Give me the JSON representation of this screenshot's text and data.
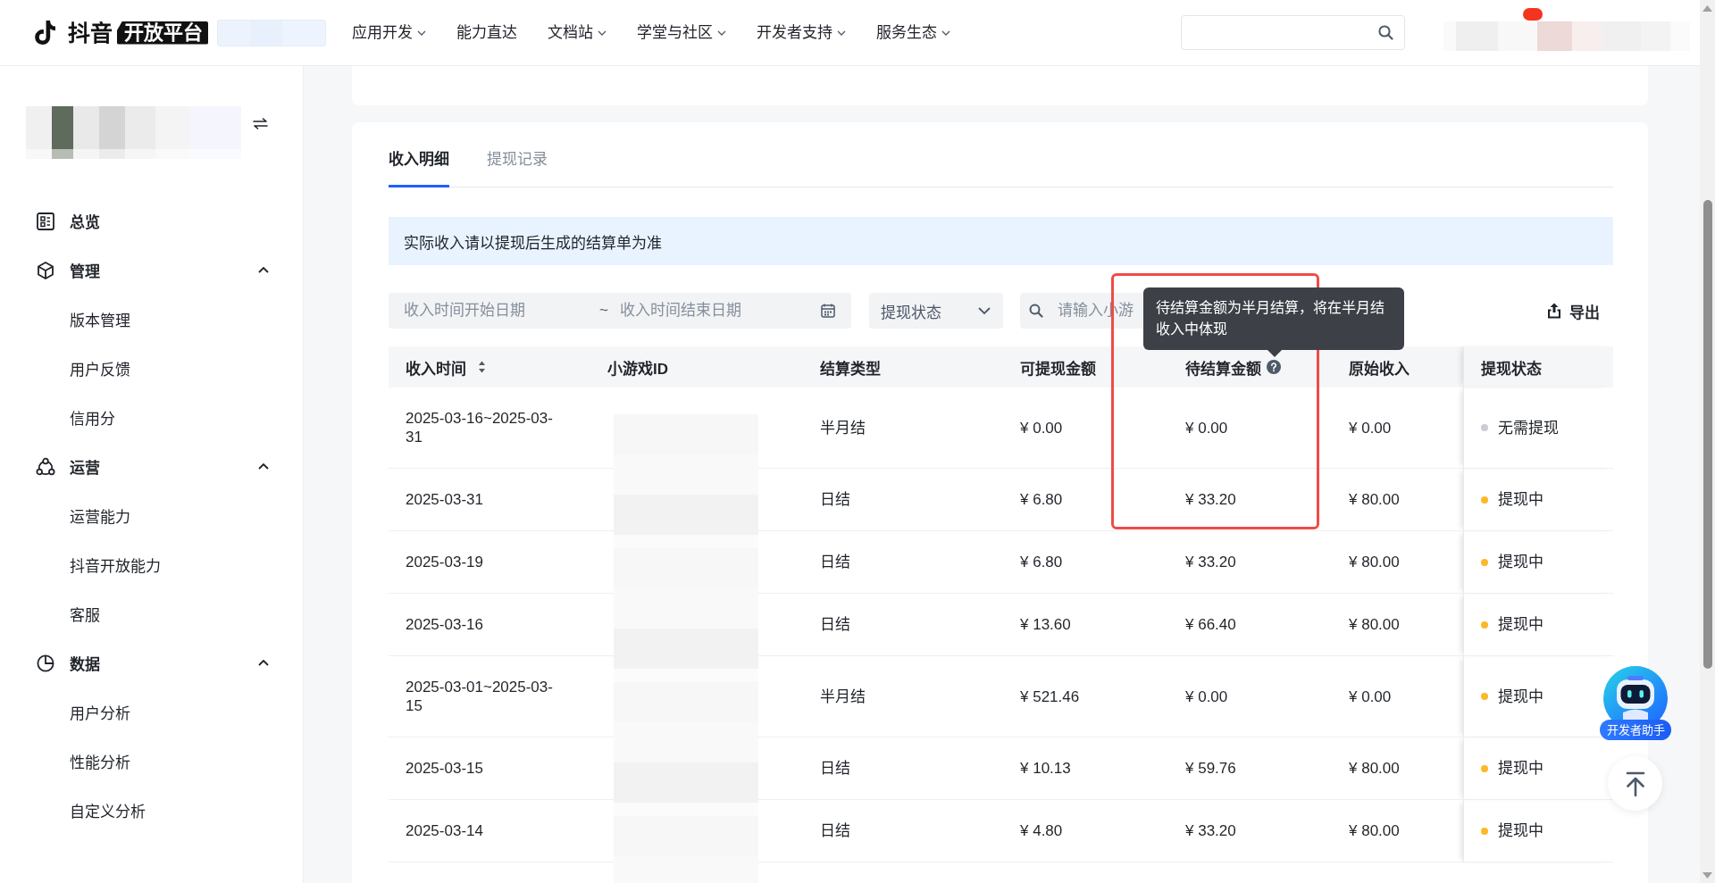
{
  "header": {
    "logo": {
      "brand": "抖音",
      "tag": "开放平台"
    },
    "nav": [
      {
        "label": "应用开发",
        "dropdown": true
      },
      {
        "label": "能力直达",
        "dropdown": false
      },
      {
        "label": "文档站",
        "dropdown": true
      },
      {
        "label": "学堂与社区",
        "dropdown": true
      },
      {
        "label": "开发者支持",
        "dropdown": true
      },
      {
        "label": "服务生态",
        "dropdown": true
      }
    ],
    "notification_badge": true
  },
  "sidebar": {
    "menu": [
      {
        "kind": "item",
        "label": "总览",
        "selected": false
      },
      {
        "kind": "group",
        "label": "管理",
        "expanded": true,
        "children": [
          {
            "label": "版本管理",
            "selected": false
          },
          {
            "label": "用户反馈",
            "selected": false
          },
          {
            "label": "信用分",
            "selected": false
          }
        ]
      },
      {
        "kind": "group",
        "label": "运营",
        "expanded": true,
        "children": [
          {
            "label": "运营能力",
            "selected": false
          },
          {
            "label": "抖音开放能力",
            "selected": false
          },
          {
            "label": "客服",
            "selected": false
          }
        ]
      },
      {
        "kind": "group",
        "label": "数据",
        "expanded": true,
        "children": [
          {
            "label": "用户分析",
            "selected": false
          },
          {
            "label": "性能分析",
            "selected": false
          },
          {
            "label": "自定义分析",
            "selected": false
          }
        ]
      }
    ]
  },
  "income": {
    "tabs": [
      {
        "label": "收入明细",
        "selected": true
      },
      {
        "label": "提现记录",
        "selected": false
      }
    ],
    "notice": "实际收入请以提现后生成的结算单为准",
    "filters": {
      "date_range": {
        "start_placeholder": "收入时间开始日期",
        "separator": "~",
        "end_placeholder": "收入时间结束日期"
      },
      "status_select": {
        "placeholder": "提现状态"
      },
      "search": {
        "placeholder": "请输入小游"
      },
      "export_label": "导出"
    },
    "table": {
      "columns": [
        {
          "label": "收入时间",
          "sortable": true,
          "help": false
        },
        {
          "label": "小游戏ID",
          "sortable": false,
          "help": false
        },
        {
          "label": "结算类型",
          "sortable": false,
          "help": false
        },
        {
          "label": "可提现金额",
          "sortable": false,
          "help": false
        },
        {
          "label": "待结算金额",
          "sortable": false,
          "help": true
        },
        {
          "label": "原始收入",
          "sortable": false,
          "help": false
        },
        {
          "label": "提现状态",
          "sortable": false,
          "help": false
        }
      ],
      "rows": [
        {
          "time": "2025-03-16~2025-03-31",
          "type": "半月结",
          "withdrawable": "¥ 0.00",
          "pending": "¥ 0.00",
          "original": "¥ 0.00",
          "status": {
            "label": "无需提现",
            "color": "#c9cdd4"
          }
        },
        {
          "time": "2025-03-31",
          "type": "日结",
          "withdrawable": "¥ 6.80",
          "pending": "¥ 33.20",
          "original": "¥ 80.00",
          "status": {
            "label": "提现中",
            "color": "#fbb829"
          }
        },
        {
          "time": "2025-03-19",
          "type": "日结",
          "withdrawable": "¥ 6.80",
          "pending": "¥ 33.20",
          "original": "¥ 80.00",
          "status": {
            "label": "提现中",
            "color": "#fbb829"
          }
        },
        {
          "time": "2025-03-16",
          "type": "日结",
          "withdrawable": "¥ 13.60",
          "pending": "¥ 66.40",
          "original": "¥ 80.00",
          "status": {
            "label": "提现中",
            "color": "#fbb829"
          }
        },
        {
          "time": "2025-03-01~2025-03-15",
          "type": "半月结",
          "withdrawable": "¥ 521.46",
          "pending": "¥ 0.00",
          "original": "¥ 0.00",
          "status": {
            "label": "提现中",
            "color": "#fbb829"
          }
        },
        {
          "time": "2025-03-15",
          "type": "日结",
          "withdrawable": "¥ 10.13",
          "pending": "¥ 59.76",
          "original": "¥ 80.00",
          "status": {
            "label": "提现中",
            "color": "#fbb829"
          }
        },
        {
          "time": "2025-03-14",
          "type": "日结",
          "withdrawable": "¥ 4.80",
          "pending": "¥ 33.20",
          "original": "¥ 80.00",
          "status": {
            "label": "提现中",
            "color": "#fbb829"
          }
        }
      ]
    },
    "tooltip": {
      "text": "待结算金额为半月结算，将在半月结收入中体现"
    }
  },
  "annotation": {
    "kind": "rectangle"
  },
  "floating": {
    "assistant_label": "开发者助手"
  }
}
